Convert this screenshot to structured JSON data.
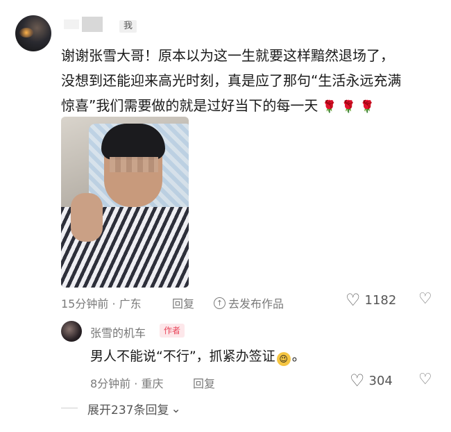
{
  "comment": {
    "me_badge": "我",
    "lines": [
      "谢谢张雪大哥！原本以为这一生就要这样黯然退场了，",
      "没想到还能迎来高光时刻，真是应了那句“生活永远充满",
      "惊喜”我们需要做的就是过好当下的每一天"
    ],
    "rose_icon": "🌹",
    "time_location": "15分钟前 · 广东",
    "reply_label": "回复",
    "post_label": "去发布作品",
    "likes": "1182"
  },
  "reply": {
    "username": "张雪的机车",
    "author_badge": "作者",
    "text_before": "男人不能说“不行”，抓紧办签证",
    "text_after": "。",
    "emoji_icon": "wink-emoji-icon",
    "time_location": "8分钟前 · 重庆",
    "reply_label": "回复",
    "likes": "304"
  },
  "expand_label": "展开237条回复",
  "colors": {
    "accent_red": "#e8455a",
    "badge_bg": "#fde7ea",
    "meta_gray": "#7a7a7a"
  }
}
